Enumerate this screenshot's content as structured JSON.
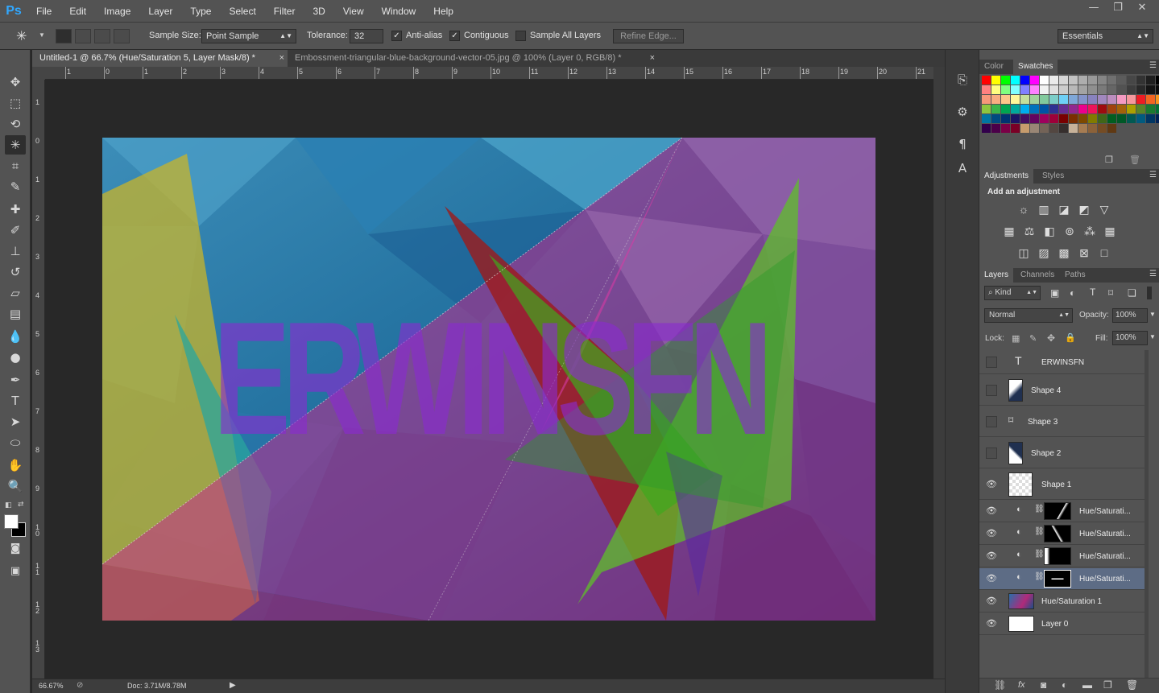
{
  "app": {
    "logo": "Ps"
  },
  "menu": [
    "File",
    "Edit",
    "Image",
    "Layer",
    "Type",
    "Select",
    "Filter",
    "3D",
    "View",
    "Window",
    "Help"
  ],
  "window_controls": {
    "minimize": "—",
    "restore": "❐",
    "close": "✕"
  },
  "options": {
    "sample_size_label": "Sample Size:",
    "sample_size_value": "Point Sample",
    "tolerance_label": "Tolerance:",
    "tolerance_value": "32",
    "anti_alias": "Anti-alias",
    "contiguous": "Contiguous",
    "sample_all_layers": "Sample All Layers",
    "refine_edge": "Refine Edge...",
    "workspace": "Essentials"
  },
  "tabs": [
    {
      "label": "Untitled-1 @ 66.7% (Hue/Saturation 5, Layer Mask/8) *"
    },
    {
      "label": "Embossment-triangular-blue-background-vector-05.jpg @ 100% (Layer 0, RGB/8) *"
    }
  ],
  "ruler_h": [
    "1",
    "0",
    "1",
    "2",
    "3",
    "4",
    "5",
    "6",
    "7",
    "8",
    "9",
    "10",
    "11",
    "12",
    "13",
    "14",
    "15",
    "16",
    "17",
    "18",
    "19",
    "20",
    "21"
  ],
  "ruler_v": [
    "1",
    "0",
    "1",
    "2",
    "3",
    "4",
    "5",
    "6",
    "7",
    "8",
    "9",
    "1 0",
    "1 1",
    "1 2",
    "1 3"
  ],
  "canvas": {
    "text": "ERWINSFN"
  },
  "status": {
    "zoom": "66.67%",
    "doc": "Doc: 3.71M/8.78M"
  },
  "panels": {
    "color_tab": "Color",
    "swatches_tab": "Swatches",
    "adjustments_tab": "Adjustments",
    "styles_tab": "Styles",
    "add_adjustment": "Add an adjustment",
    "layers_tab": "Layers",
    "channels_tab": "Channels",
    "paths_tab": "Paths",
    "kind_label": "Kind",
    "blend_mode": "Normal",
    "opacity_label": "Opacity:",
    "opacity_value": "100%",
    "lock_label": "Lock:",
    "fill_label": "Fill:",
    "fill_value": "100%"
  },
  "layers": [
    {
      "name": "ERWINSFN",
      "visible": false
    },
    {
      "name": "Shape 4",
      "visible": false
    },
    {
      "name": "Shape 3",
      "visible": false
    },
    {
      "name": "Shape 2",
      "visible": false
    },
    {
      "name": "Shape 1",
      "visible": true
    },
    {
      "name": "Hue/Saturati...",
      "visible": true
    },
    {
      "name": "Hue/Saturati...",
      "visible": true
    },
    {
      "name": "Hue/Saturati...",
      "visible": true
    },
    {
      "name": "Hue/Saturati...",
      "visible": true,
      "selected": true
    },
    {
      "name": "Hue/Saturation 1",
      "visible": true
    },
    {
      "name": "Layer 0",
      "visible": true
    }
  ],
  "swatch_colors": [
    [
      "#ff0000",
      "#ffff00",
      "#00ff00",
      "#00ffff",
      "#0000ff",
      "#ff00ff",
      "#ffffff",
      "#ebebeb",
      "#d6d6d6",
      "#c2c2c2",
      "#adadad",
      "#999999",
      "#858585",
      "#707070",
      "#5c5c5c",
      "#474747",
      "#333333",
      "#1f1f1f",
      "#000000",
      "#ff0000"
    ],
    [
      "#ff8080",
      "#ffff80",
      "#80ff80",
      "#80ffff",
      "#8080ff",
      "#ff80ff",
      "#f2f2f2",
      "#e0e0e0",
      "#cccccc",
      "#b8b8b8",
      "#a3a3a3",
      "#8f8f8f",
      "#7a7a7a",
      "#666666",
      "#525252",
      "#3d3d3d",
      "#292929",
      "#141414",
      "#0a0a0a",
      "#f5a3a3"
    ],
    [
      "#f7977a",
      "#f9ad81",
      "#fdc68a",
      "#fff79a",
      "#c4df9b",
      "#a2d39c",
      "#82ca9d",
      "#7bcdc8",
      "#6ecff6",
      "#7ea7d8",
      "#8493ca",
      "#8882be",
      "#a187be",
      "#bc8dbf",
      "#f49ac2",
      "#f6989d",
      "#ed1c24",
      "#f26522",
      "#f7941d",
      "#fff200"
    ],
    [
      "#8dc63f",
      "#39b54a",
      "#00a651",
      "#00a99d",
      "#00aeef",
      "#0072bc",
      "#0054a6",
      "#2e3192",
      "#662d91",
      "#92278f",
      "#ec008c",
      "#ed145b",
      "#9e0b0f",
      "#a0410d",
      "#a36209",
      "#aba000",
      "#598527",
      "#1a7b30",
      "#007236",
      "#00746b"
    ],
    [
      "#0076a3",
      "#004b80",
      "#003471",
      "#1b1464",
      "#440e62",
      "#630460",
      "#9e005d",
      "#9e0039",
      "#790000",
      "#7b2e00",
      "#7d4900",
      "#827b00",
      "#406618",
      "#005e20",
      "#005826",
      "#005952",
      "#005b7f",
      "#003663",
      "#002157",
      "#0d004c"
    ],
    [
      "#32004b",
      "#4b0049",
      "#7b0046",
      "#7a0026",
      "#c69c6d",
      "#998675",
      "#736357",
      "#534741",
      "#362f2d",
      "#c7b299",
      "#a67c52",
      "#8c6239",
      "#754c24",
      "#603913"
    ]
  ]
}
